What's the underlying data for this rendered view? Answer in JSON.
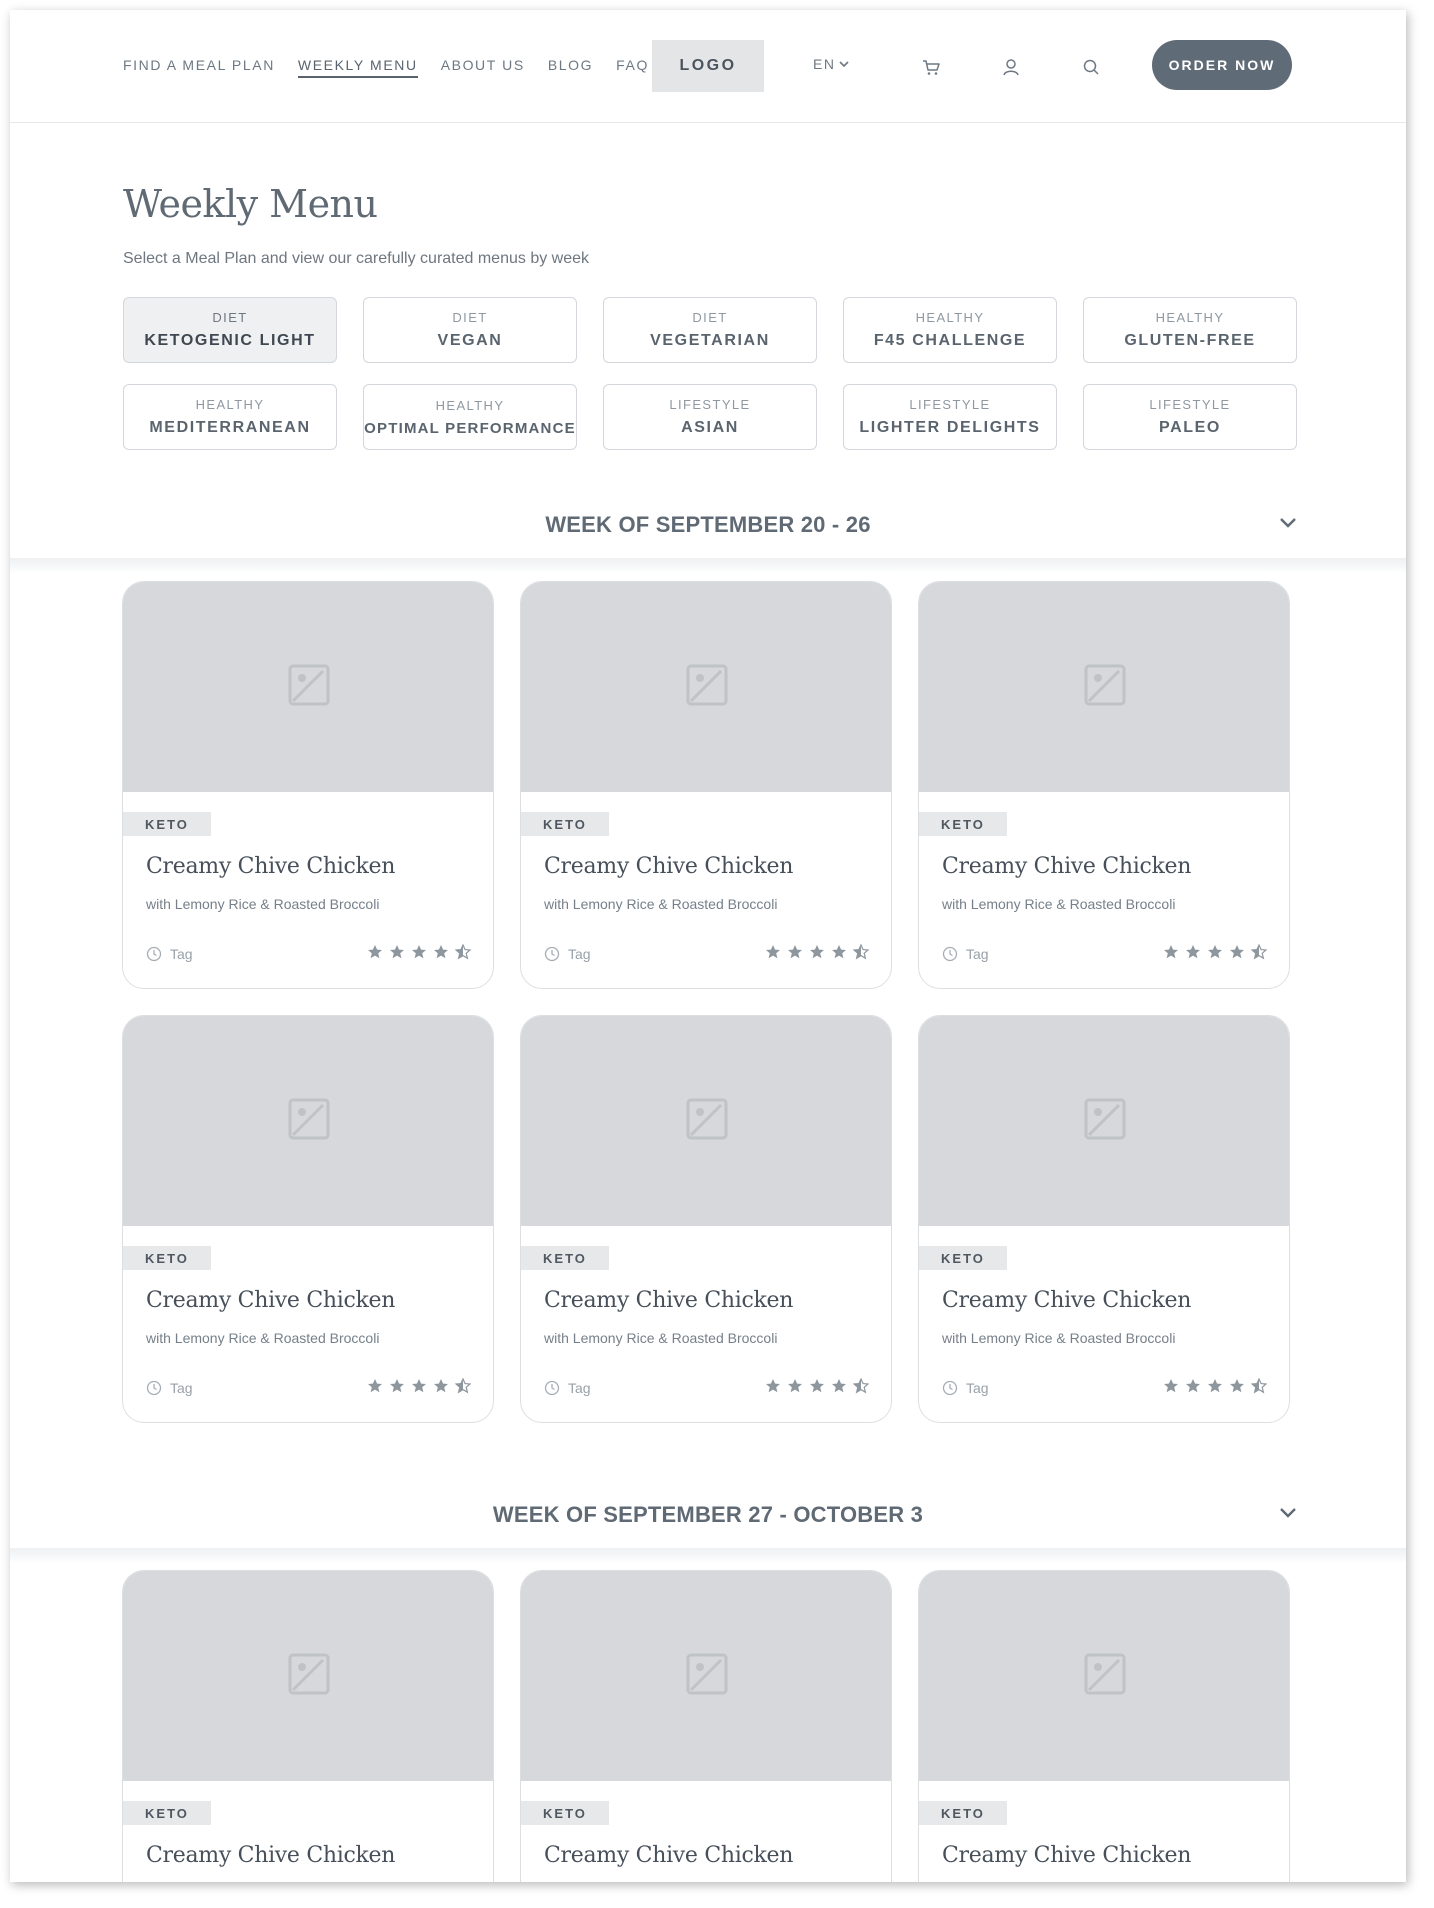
{
  "header": {
    "nav": [
      "FIND A MEAL PLAN",
      "WEEKLY MENU",
      "ABOUT US",
      "BLOG",
      "FAQ"
    ],
    "active_nav": "WEEKLY MENU",
    "logo": "LOGO",
    "language": "EN",
    "order_button": "ORDER NOW",
    "icons": [
      "cart-icon",
      "user-icon",
      "search-icon"
    ]
  },
  "main": {
    "title": "Weekly Menu",
    "subtitle": "Select a Meal Plan and view our carefully curated menus by week"
  },
  "plans": [
    {
      "category": "DIET",
      "name": "KETOGENIC LIGHT",
      "selected": true
    },
    {
      "category": "DIET",
      "name": "VEGAN"
    },
    {
      "category": "DIET",
      "name": "VEGETARIAN"
    },
    {
      "category": "HEALTHY",
      "name": "F45 CHALLENGE"
    },
    {
      "category": "HEALTHY",
      "name": "GLUTEN-FREE"
    },
    {
      "category": "HEALTHY",
      "name": "MEDITERRANEAN"
    },
    {
      "category": "HEALTHY",
      "name": "OPTIMAL PERFORMANCE"
    },
    {
      "category": "LIFESTYLE",
      "name": "ASIAN"
    },
    {
      "category": "LIFESTYLE",
      "name": "LIGHTER DELIGHTS"
    },
    {
      "category": "LIFESTYLE",
      "name": "PALEO"
    }
  ],
  "weeks": [
    {
      "title": "WEEK OF SEPTEMBER 20 - 26",
      "meals": [
        {
          "tag": "KETO",
          "title": "Creamy Chive Chicken",
          "subtitle": "with Lemony Rice & Roasted Broccoli",
          "meta": "Tag",
          "rating": 4.5
        },
        {
          "tag": "KETO",
          "title": "Creamy Chive Chicken",
          "subtitle": "with Lemony Rice & Roasted Broccoli",
          "meta": "Tag",
          "rating": 4.5
        },
        {
          "tag": "KETO",
          "title": "Creamy Chive Chicken",
          "subtitle": "with Lemony Rice & Roasted Broccoli",
          "meta": "Tag",
          "rating": 4.5
        },
        {
          "tag": "KETO",
          "title": "Creamy Chive Chicken",
          "subtitle": "with Lemony Rice & Roasted Broccoli",
          "meta": "Tag",
          "rating": 4.5
        },
        {
          "tag": "KETO",
          "title": "Creamy Chive Chicken",
          "subtitle": "with Lemony Rice & Roasted Broccoli",
          "meta": "Tag",
          "rating": 4.5
        },
        {
          "tag": "KETO",
          "title": "Creamy Chive Chicken",
          "subtitle": "with Lemony Rice & Roasted Broccoli",
          "meta": "Tag",
          "rating": 4.5
        }
      ]
    },
    {
      "title": "WEEK OF SEPTEMBER 27 - OCTOBER 3",
      "meals": [
        {
          "tag": "KETO",
          "title": "Creamy Chive Chicken"
        },
        {
          "tag": "KETO",
          "title": "Creamy Chive Chicken"
        },
        {
          "tag": "KETO",
          "title": "Creamy Chive Chicken"
        }
      ]
    }
  ],
  "colors": {
    "accent": "#5f6b76",
    "placeholder": "#d6d8db",
    "text": "#47505a",
    "muted": "#98a0a8"
  }
}
